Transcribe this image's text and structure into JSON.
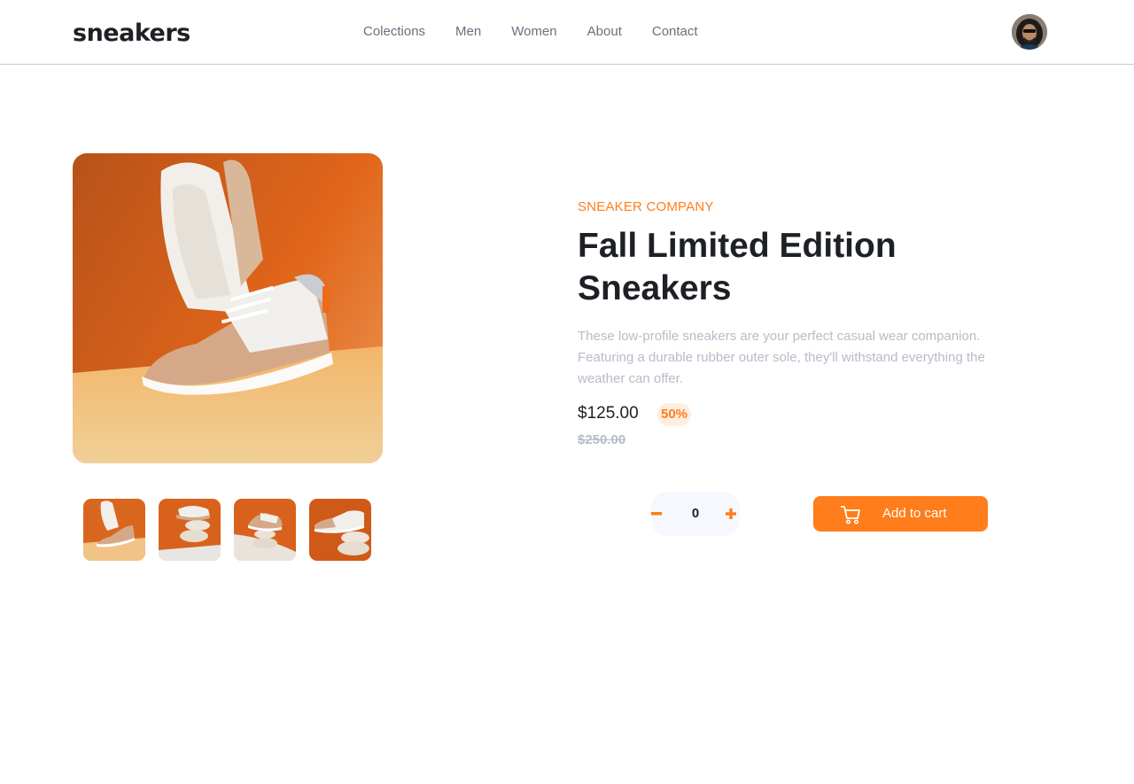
{
  "header": {
    "logo": "sneakers",
    "nav": [
      "Colections",
      "Men",
      "Women",
      "About",
      "Contact"
    ],
    "avatar_icon": "user-avatar-icon"
  },
  "gallery": {
    "thumbnail_count": 4,
    "main_image": "product-image-1",
    "thumbnails": [
      "product-thumbnail-1",
      "product-thumbnail-2",
      "product-thumbnail-3",
      "product-thumbnail-4"
    ]
  },
  "product": {
    "company": "SNEAKER COMPANY",
    "title": "Fall Limited Edition Sneakers",
    "description": "These low-profile sneakers are your perfect casual wear companion. Featuring a durable rubber outer sole, they'll withstand everything the weather can offer.",
    "price": "$125.00",
    "discount": "50%",
    "original_price": "$250.00"
  },
  "cart": {
    "quantity": "0",
    "minus_icon": "minus-icon",
    "plus_icon": "plus-icon",
    "add_label": "Add to cart",
    "cart_icon": "cart-icon"
  },
  "colors": {
    "accent": "#ff7d1a",
    "accent_pale": "#ffede0",
    "text_dark": "#1d2025",
    "text_gray": "#69707d",
    "text_light": "#b6bcc8",
    "qty_bg": "#f7f8fd"
  }
}
